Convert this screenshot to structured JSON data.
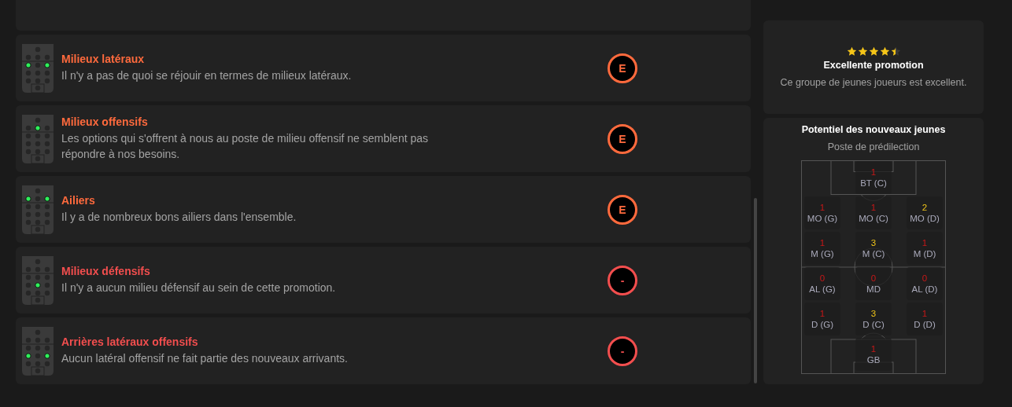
{
  "needs": [
    {
      "title": "Milieux latéraux",
      "text": "Il n'y a pas de quoi se réjouir en termes de milieux latéraux.",
      "grade": "E",
      "color": "#ff6a3d",
      "pitch": [
        [
          false
        ],
        [
          false,
          false,
          false
        ],
        [
          true,
          false,
          true
        ],
        [
          false,
          false,
          false
        ],
        [
          false,
          false,
          false
        ],
        [
          false
        ]
      ]
    },
    {
      "title": "Milieux offensifs",
      "text": "Les options qui s'offrent à nous au poste de milieu offensif ne semblent pas répondre à nos besoins.",
      "grade": "E",
      "color": "#ff6a3d",
      "pitch": [
        [
          false
        ],
        [
          false,
          true,
          false
        ],
        [
          false,
          false,
          false
        ],
        [
          false,
          false,
          false
        ],
        [
          false,
          false,
          false
        ],
        [
          false
        ]
      ]
    },
    {
      "title": "Ailiers",
      "text": "Il y a de nombreux bons ailiers dans l'ensemble.",
      "grade": "E",
      "color": "#ff6a3d",
      "pitch": [
        [
          false
        ],
        [
          true,
          false,
          true
        ],
        [
          false,
          false,
          false
        ],
        [
          false,
          false,
          false
        ],
        [
          false,
          false,
          false
        ],
        [
          false
        ]
      ]
    },
    {
      "title": "Milieux défensifs",
      "text": "Il n'y a aucun milieu défensif au sein de cette promotion.",
      "grade": "-",
      "color": "#f24e4e",
      "pitch": [
        [
          false
        ],
        [
          false,
          false,
          false
        ],
        [
          false,
          false,
          false
        ],
        [
          false,
          true,
          false
        ],
        [
          false,
          false,
          false
        ],
        [
          false
        ]
      ]
    },
    {
      "title": "Arrières latéraux offensifs",
      "text": "Aucun latéral offensif ne fait partie des nouveaux arrivants.",
      "grade": "-",
      "color": "#f24e4e",
      "pitch": [
        [
          false
        ],
        [
          false,
          false,
          false
        ],
        [
          false,
          false,
          false
        ],
        [
          true,
          false,
          true
        ],
        [
          false,
          false,
          false
        ],
        [
          false
        ]
      ]
    }
  ],
  "rating": {
    "stars": 4.5,
    "title": "Excellente promotion",
    "text": "Ce groupe de jeunes joueurs est excellent."
  },
  "potential": {
    "title": "Potentiel des nouveaux jeunes",
    "subtitle": "Poste de prédilection",
    "rows": [
      {
        "cells": [
          {
            "count": "1",
            "label": "BT (C)",
            "kind": "low"
          }
        ]
      },
      {
        "cells": [
          {
            "count": "1",
            "label": "MO (G)",
            "kind": "low"
          },
          {
            "count": "1",
            "label": "MO (C)",
            "kind": "low"
          },
          {
            "count": "2",
            "label": "MO (D)",
            "kind": "good"
          }
        ]
      },
      {
        "cells": [
          {
            "count": "1",
            "label": "M (G)",
            "kind": "low"
          },
          {
            "count": "3",
            "label": "M (C)",
            "kind": "good"
          },
          {
            "count": "1",
            "label": "M (D)",
            "kind": "low"
          }
        ]
      },
      {
        "cells": [
          {
            "count": "0",
            "label": "AL (G)",
            "kind": "low"
          },
          {
            "count": "0",
            "label": "MD",
            "kind": "low"
          },
          {
            "count": "0",
            "label": "AL (D)",
            "kind": "low"
          }
        ]
      },
      {
        "cells": [
          {
            "count": "1",
            "label": "D (G)",
            "kind": "low"
          },
          {
            "count": "3",
            "label": "D (C)",
            "kind": "good"
          },
          {
            "count": "1",
            "label": "D (D)",
            "kind": "low"
          }
        ]
      },
      {
        "cells": [
          {
            "count": "1",
            "label": "GB",
            "kind": "low"
          }
        ]
      }
    ]
  }
}
